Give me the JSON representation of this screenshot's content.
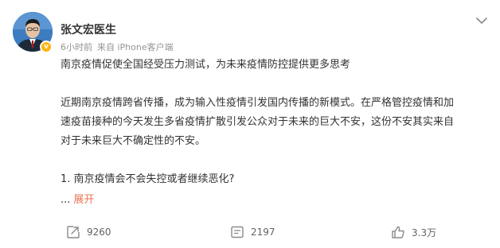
{
  "post": {
    "author": "张文宏医生",
    "time": "6小时前",
    "source": "来自 iPhone客户端",
    "badge": "v",
    "paragraphs": [
      "南京疫情促使全国经受压力测试，为未来疫情防控提供更多思考",
      "近期南京疫情跨省传播，成为输入性疫情引发国内传播的新模式。在严格管控疫情和加\n速疫苗接种的今天发生多省疫情扩散引发公众对于未来的巨大不安，这份不安其实来自\n对于未来巨大不确定性的不安。",
      "1. 南京疫情会不会失控或者继续恶化?"
    ],
    "ellipsis": "...",
    "expand_label": "展开"
  },
  "actions": {
    "repost_count": "9260",
    "comment_count": "2197",
    "like_count": "3.3万"
  },
  "icons": {
    "more": "chevron-down-icon",
    "repost": "repost-icon",
    "comment": "comment-icon",
    "like": "thumbs-up-icon"
  },
  "colors": {
    "link": "#eb7350",
    "badge": "#ffb30f",
    "meta": "#939393"
  }
}
